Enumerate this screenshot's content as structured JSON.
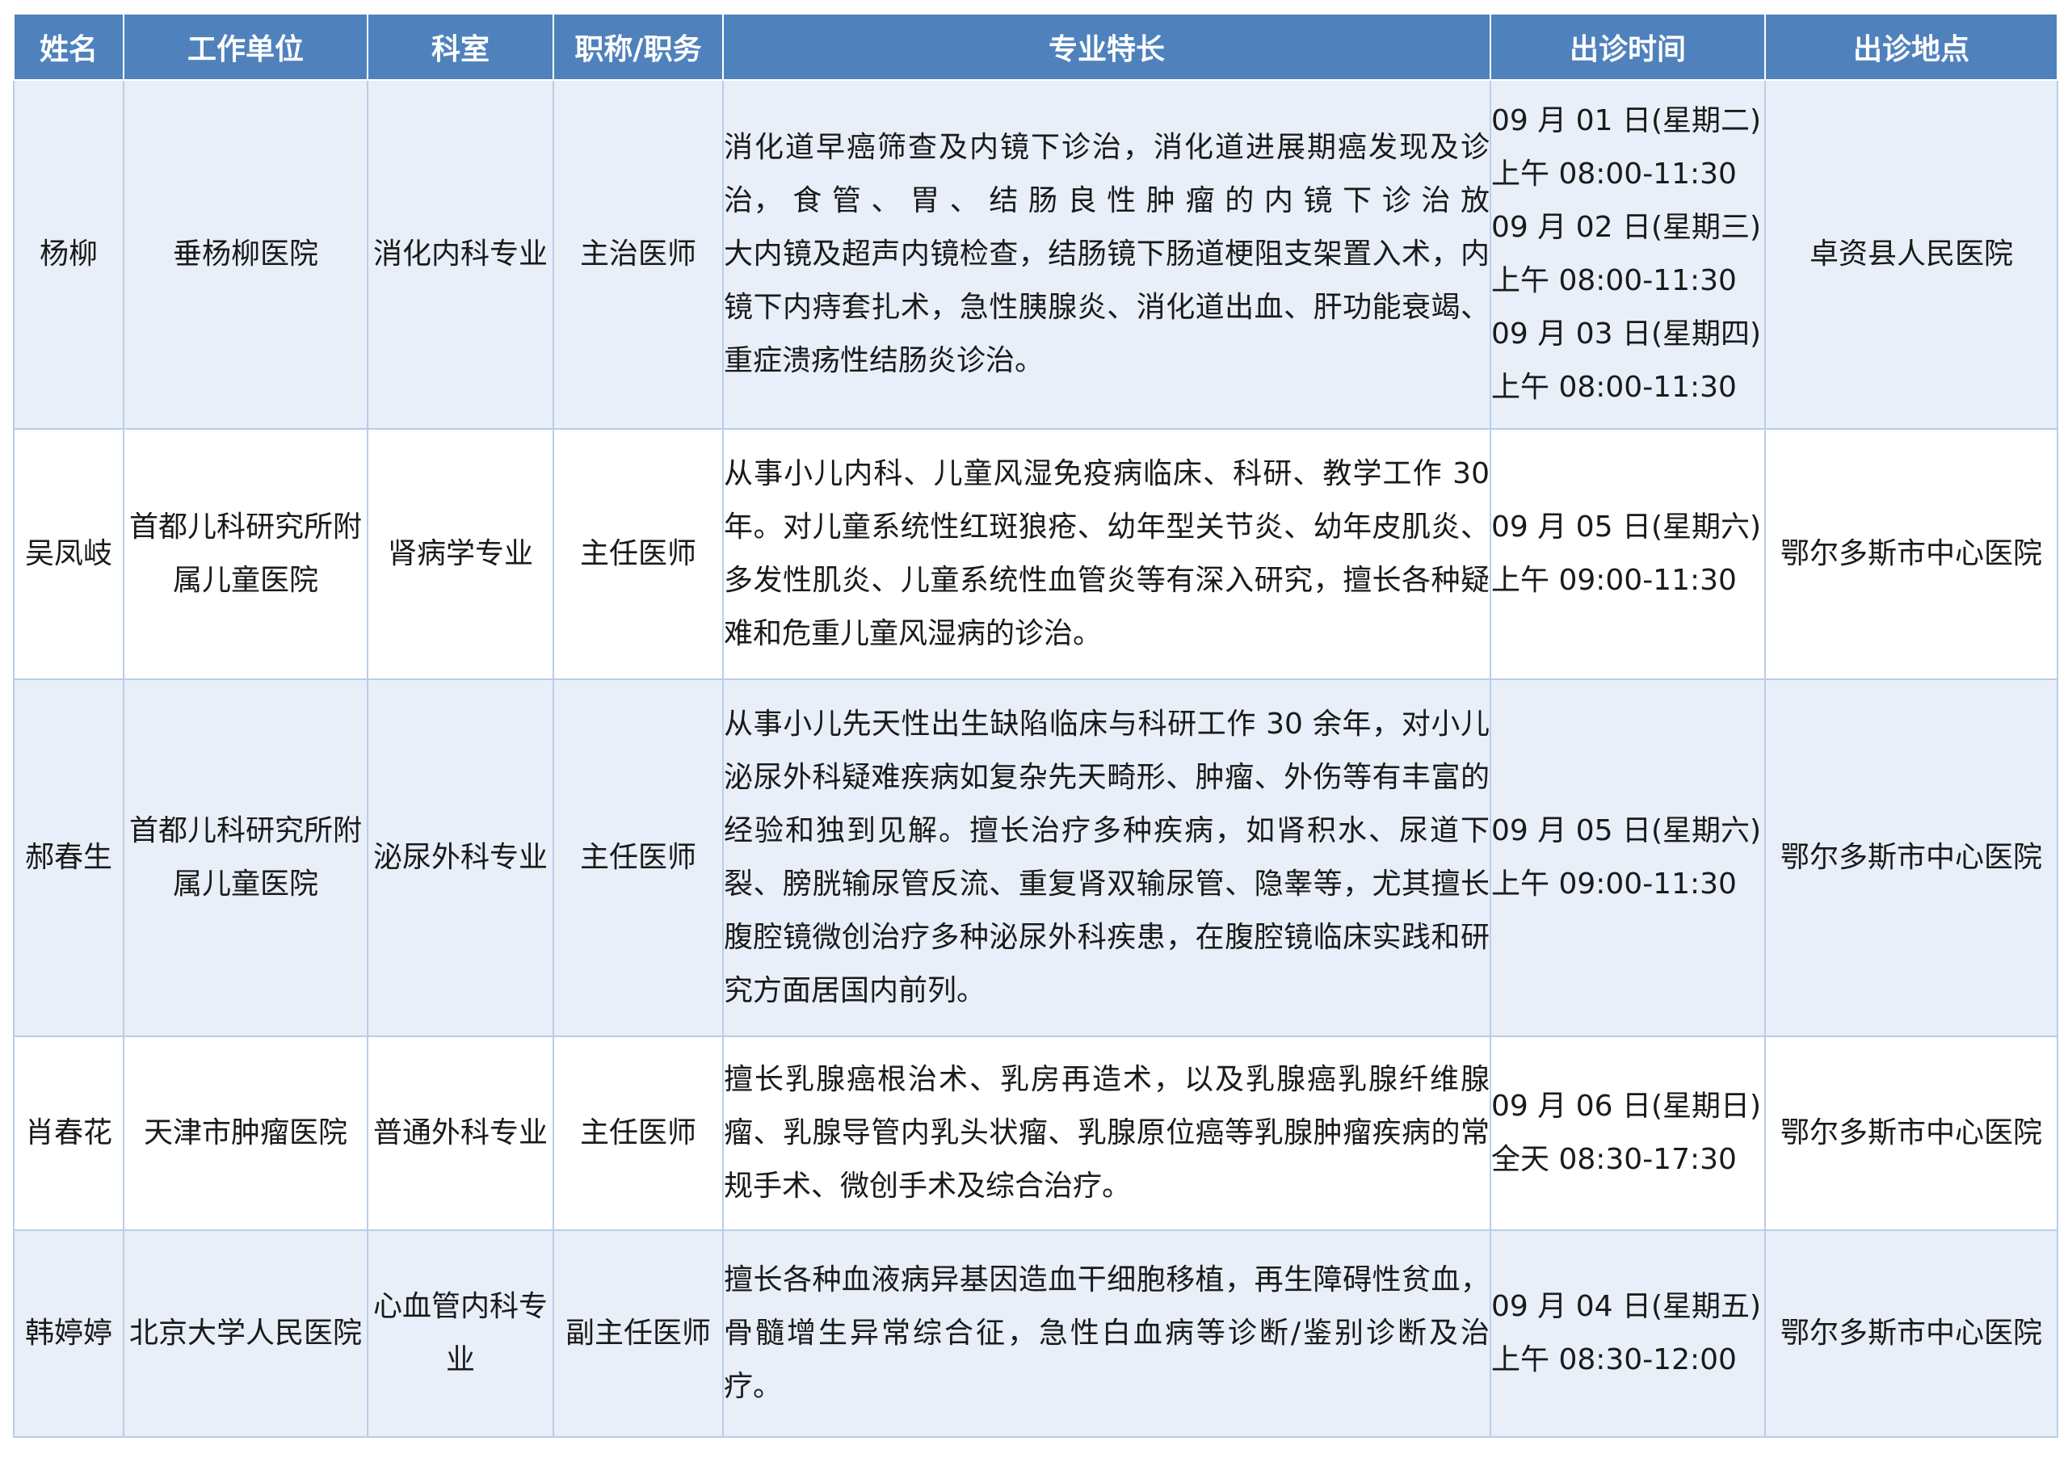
{
  "table": {
    "headers": {
      "name": "姓名",
      "unit": "工作单位",
      "dept": "科室",
      "title": "职称/职务",
      "specialty": "专业特长",
      "time": "出诊时间",
      "place": "出诊地点"
    },
    "rows": [
      {
        "name": "杨柳",
        "unit": "垂杨柳医院",
        "dept": "消化内科专业",
        "title": "主治医师",
        "specialty": "消化道早癌筛查及内镜下诊治，消化道进展期癌发现及诊治， 食 管 、 胃 、 结 肠 良 性 肿 瘤 的 内 镜 下 诊 治 放大内镜及超声内镜检查，结肠镜下肠道梗阻支架置入术，内镜下内痔套扎术，急性胰腺炎、消化道出血、肝功能衰竭、重症溃疡性结肠炎诊治。",
        "time": [
          "09 月 01 日(星期二)",
          "上午 08:00-11:30",
          "09 月 02 日(星期三)",
          "上午 08:00-11:30",
          "09 月 03 日(星期四)",
          "上午 08:00-11:30"
        ],
        "place": "卓资县人民医院"
      },
      {
        "name": "吴凤岐",
        "unit": "首都儿科研究所附属儿童医院",
        "dept": "肾病学专业",
        "title": "主任医师",
        "specialty": "从事小儿内科、儿童风湿免疫病临床、科研、教学工作 30 年。对儿童系统性红斑狼疮、幼年型关节炎、幼年皮肌炎、多发性肌炎、儿童系统性血管炎等有深入研究，擅长各种疑难和危重儿童风湿病的诊治。",
        "time": [
          "09 月 05 日(星期六)",
          "上午 09:00-11:30"
        ],
        "place": "鄂尔多斯市中心医院"
      },
      {
        "name": "郝春生",
        "unit": "首都儿科研究所附属儿童医院",
        "dept": "泌尿外科专业",
        "title": "主任医师",
        "specialty": "从事小儿先天性出生缺陷临床与科研工作 30 余年，对小儿泌尿外科疑难疾病如复杂先天畸形、肿瘤、外伤等有丰富的经验和独到见解。擅长治疗多种疾病，如肾积水、尿道下裂、膀胱输尿管反流、重复肾双输尿管、隐睾等，尤其擅长腹腔镜微创治疗多种泌尿外科疾患，在腹腔镜临床实践和研究方面居国内前列。",
        "time": [
          "09 月 05 日(星期六)",
          "上午 09:00-11:30"
        ],
        "place": "鄂尔多斯市中心医院"
      },
      {
        "name": "肖春花",
        "unit": "天津市肿瘤医院",
        "dept": "普通外科专业",
        "title": "主任医师",
        "specialty": "擅长乳腺癌根治术、乳房再造术，以及乳腺癌乳腺纤维腺瘤、乳腺导管内乳头状瘤、乳腺原位癌等乳腺肿瘤疾病的常规手术、微创手术及综合治疗。",
        "time": [
          "09 月 06 日(星期日)",
          "全天 08:30-17:30"
        ],
        "place": "鄂尔多斯市中心医院"
      },
      {
        "name": "韩婷婷",
        "unit": "北京大学人民医院",
        "dept": "心血管内科专业",
        "title": "副主任医师",
        "specialty": "擅长各种血液病异基因造血干细胞移植，再生障碍性贫血，骨髓增生异常综合征，急性白血病等诊断/鉴别诊断及治疗。",
        "time": [
          "09 月 04 日(星期五)",
          "上午 08:30-12:00"
        ],
        "place": "鄂尔多斯市中心医院"
      }
    ]
  }
}
